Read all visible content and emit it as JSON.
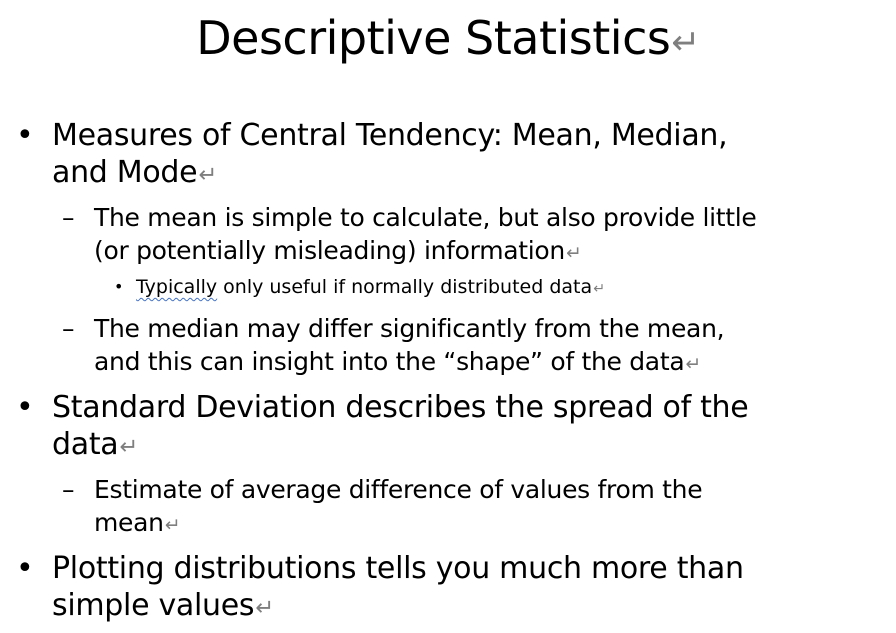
{
  "title": "Descriptive Statistics",
  "paragraph_mark": "↵",
  "bullets": {
    "level1": "•",
    "level2": "–",
    "level3": "•"
  },
  "colors": {
    "text": "#000000",
    "paragraph_mark": "#7f7f7f",
    "spell_check_underline": "#4472c4"
  },
  "content": {
    "central_tendency": {
      "line1": "Measures of Central Tendency: Mean, Median,",
      "line2": "and Mode",
      "mean_note": {
        "line1": "The mean is simple to calculate, but also provide little",
        "line2": "(or potentially misleading) information",
        "sub": {
          "flagged_word": "Typically",
          "rest": " only useful if normally distributed data"
        }
      },
      "median_note": {
        "line1": "The median may differ significantly from the mean,",
        "line2": "and this can insight into the “shape” of the data"
      }
    },
    "std_dev": {
      "line1": "Standard Deviation describes the spread of the",
      "line2": "data",
      "note": {
        "line1": "Estimate of average difference of values from the",
        "line2": "mean"
      }
    },
    "plotting": {
      "line1": "Plotting distributions tells you much more than",
      "line2": "simple values"
    }
  }
}
